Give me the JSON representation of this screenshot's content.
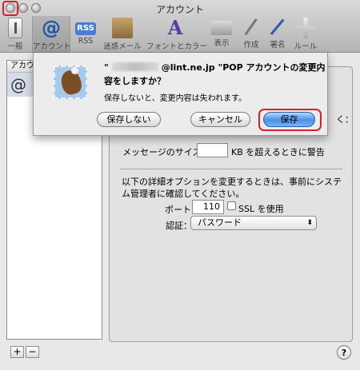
{
  "window": {
    "title": "アカウント"
  },
  "toolbar": {
    "items": [
      {
        "label": "一般",
        "icon": "general-icon"
      },
      {
        "label": "アカウント",
        "icon": "accounts-at-icon"
      },
      {
        "label": "RSS",
        "icon": "rss-icon"
      },
      {
        "label": "迷惑メール",
        "icon": "junk-mail-icon"
      },
      {
        "label": "フォントとカラー",
        "icon": "fonts-colors-icon"
      },
      {
        "label": "表示",
        "icon": "viewing-icon"
      },
      {
        "label": "作成",
        "icon": "composing-icon"
      },
      {
        "label": "署名",
        "icon": "signatures-icon"
      },
      {
        "label": "ルール",
        "icon": "rules-icon"
      }
    ],
    "rss_badge": "RSS",
    "accounts_glyph": "@",
    "fonts_glyph": "A"
  },
  "sidebar": {
    "header": "アカウ",
    "row_icon_glyph": "@",
    "add_label": "+",
    "remove_label": "−"
  },
  "detail": {
    "partial_right": "く：",
    "message_size_label": "メッセージのサイズが",
    "message_size_value": "",
    "message_size_suffix": "KB を超えるときに警告",
    "advanced_note": "以下の詳細オプションを変更するときは、事前にシステム管理者に確認してください。",
    "port_label": "ポート：",
    "port_value": "110",
    "ssl_label": "SSL を使用",
    "ssl_checked": false,
    "auth_label": "認証：",
    "auth_value": "パスワード",
    "auth_arrow": "⬍"
  },
  "help": {
    "label": "?"
  },
  "sheet": {
    "title_prefix": "\"",
    "title_suffix": "@lint.ne.jp \"POP アカウントの変更内",
    "title_line2": "容をしますか？",
    "body": "保存しないと、変更内容は失われます。",
    "buttons": {
      "dont_save": "保存しない",
      "cancel": "キャンセル",
      "save": "保存"
    }
  },
  "colors": {
    "highlight": "#d6202a",
    "default_button": "#4a8fe8"
  }
}
